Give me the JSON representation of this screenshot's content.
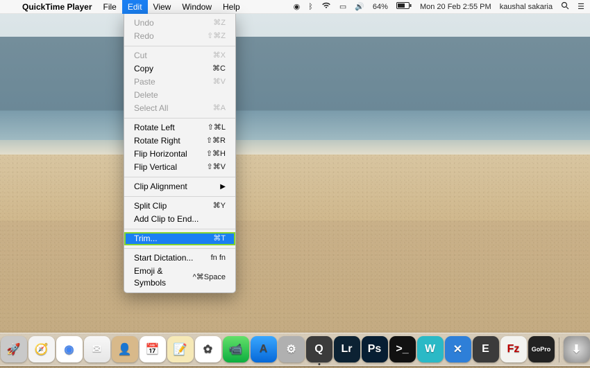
{
  "menubar": {
    "apple": "",
    "app_name": "QuickTime Player",
    "items": [
      "File",
      "Edit",
      "View",
      "Window",
      "Help"
    ],
    "active_index": 1,
    "status": {
      "battery_pct": "64%",
      "datetime": "Mon 20 Feb  2:55 PM",
      "user": "kaushal sakaria"
    }
  },
  "edit_menu": {
    "groups": [
      [
        {
          "label": "Undo",
          "shortcut": "⌘Z",
          "disabled": true
        },
        {
          "label": "Redo",
          "shortcut": "⇧⌘Z",
          "disabled": true
        }
      ],
      [
        {
          "label": "Cut",
          "shortcut": "⌘X",
          "disabled": true
        },
        {
          "label": "Copy",
          "shortcut": "⌘C",
          "disabled": false
        },
        {
          "label": "Paste",
          "shortcut": "⌘V",
          "disabled": true
        },
        {
          "label": "Delete",
          "shortcut": "",
          "disabled": true
        },
        {
          "label": "Select All",
          "shortcut": "⌘A",
          "disabled": true
        }
      ],
      [
        {
          "label": "Rotate Left",
          "shortcut": "⇧⌘L",
          "disabled": false
        },
        {
          "label": "Rotate Right",
          "shortcut": "⇧⌘R",
          "disabled": false
        },
        {
          "label": "Flip Horizontal",
          "shortcut": "⇧⌘H",
          "disabled": false
        },
        {
          "label": "Flip Vertical",
          "shortcut": "⇧⌘V",
          "disabled": false
        }
      ],
      [
        {
          "label": "Clip Alignment",
          "shortcut": "",
          "submenu": true,
          "disabled": false
        }
      ],
      [
        {
          "label": "Split Clip",
          "shortcut": "⌘Y",
          "disabled": false
        },
        {
          "label": "Add Clip to End...",
          "shortcut": "",
          "disabled": false
        }
      ],
      [
        {
          "label": "Trim...",
          "shortcut": "⌘T",
          "disabled": false,
          "selected": true
        }
      ],
      [
        {
          "label": "Start Dictation...",
          "shortcut": "fn fn",
          "disabled": false
        },
        {
          "label": "Emoji & Symbols",
          "shortcut": "^⌘Space",
          "disabled": false
        }
      ]
    ]
  },
  "dock": {
    "apps": [
      {
        "name": "finder",
        "bg": "linear-gradient(#4aa8f0,#1e6fd0)",
        "glyph": "☻"
      },
      {
        "name": "launchpad",
        "bg": "#c9c9c9",
        "glyph": "🚀"
      },
      {
        "name": "safari",
        "bg": "#f4f4f4",
        "glyph": "🧭"
      },
      {
        "name": "chrome",
        "bg": "#ffffff",
        "glyph": "◉"
      },
      {
        "name": "mail",
        "bg": "linear-gradient(#f7f7f7,#e6e6e6)",
        "glyph": "✉"
      },
      {
        "name": "contacts",
        "bg": "#d8b98a",
        "glyph": "👤"
      },
      {
        "name": "calendar",
        "bg": "#ffffff",
        "glyph": "📅"
      },
      {
        "name": "notes",
        "bg": "#f6e9b7",
        "glyph": "📝"
      },
      {
        "name": "photos",
        "bg": "#ffffff",
        "glyph": "✿"
      },
      {
        "name": "facetime",
        "bg": "linear-gradient(#63e06a,#0cae3f)",
        "glyph": "📹"
      },
      {
        "name": "appstore",
        "bg": "linear-gradient(#39a7ff,#0668d8)",
        "glyph": "A"
      },
      {
        "name": "preferences",
        "bg": "#b0b0b0",
        "glyph": "⚙"
      },
      {
        "name": "quicktime",
        "bg": "#3b3b3b",
        "glyph": "Q",
        "dot": true
      },
      {
        "name": "lightroom",
        "bg": "#0c2233",
        "glyph": "Lr"
      },
      {
        "name": "photoshop",
        "bg": "#071e33",
        "glyph": "Ps"
      },
      {
        "name": "terminal",
        "bg": "#111",
        "glyph": ">_"
      },
      {
        "name": "wunderlist",
        "bg": "#2bb9c6",
        "glyph": "W"
      },
      {
        "name": "xcode",
        "bg": "#2e7fd8",
        "glyph": "✕"
      },
      {
        "name": "evernote",
        "bg": "#3b3b3b",
        "glyph": "E"
      },
      {
        "name": "filezilla",
        "bg": "#f3f3f0",
        "glyph": "Fz"
      },
      {
        "name": "gopro",
        "bg": "#222",
        "glyph": "GoPro"
      }
    ],
    "right": [
      {
        "name": "downloads",
        "bg": "radial-gradient(#ddd,#888)",
        "glyph": "⬇"
      },
      {
        "name": "trash",
        "bg": "transparent",
        "glyph": "🗑"
      }
    ]
  }
}
